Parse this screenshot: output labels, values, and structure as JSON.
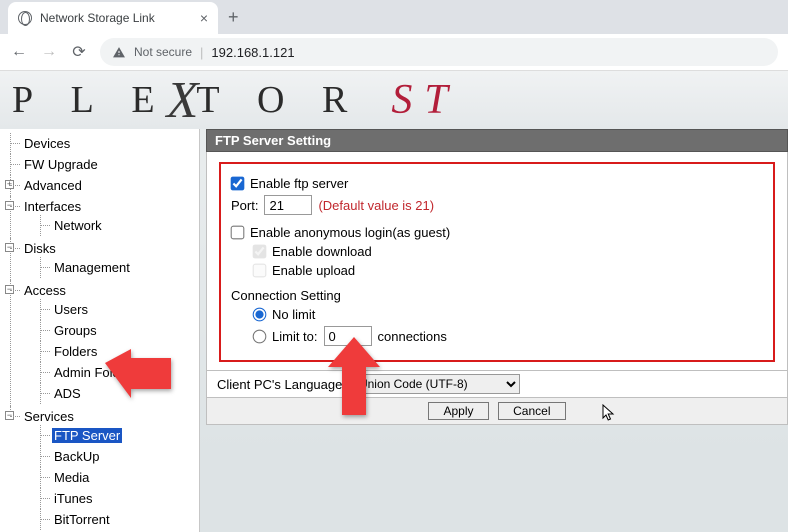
{
  "browser": {
    "tab_title": "Network Storage Link",
    "not_secure": "Not secure",
    "url": "192.168.1.121"
  },
  "logo": {
    "main": "PLEXTOR",
    "sub": "ST"
  },
  "sidebar": {
    "devices": "Devices",
    "fw": "FW Upgrade",
    "advanced": "Advanced",
    "interfaces": "Interfaces",
    "network": "Network",
    "disks": "Disks",
    "management": "Management",
    "access": "Access",
    "users": "Users",
    "groups": "Groups",
    "folders": "Folders",
    "admin_folder": "Admin Folder",
    "ads": "ADS",
    "services": "Services",
    "ftp": "FTP Server",
    "backup": "BackUp",
    "media": "Media",
    "itunes": "iTunes",
    "bittorrent": "BitTorrent"
  },
  "panel": {
    "header": "FTP Server Setting",
    "enable_ftp": "Enable ftp server",
    "port_label": "Port:",
    "port_value": "21",
    "default_hint": "(Default value is 21)",
    "enable_anon": "Enable anonymous login(as guest)",
    "enable_download": "Enable download",
    "enable_upload": "Enable upload",
    "conn_setting": "Connection Setting",
    "no_limit": "No limit",
    "limit_to": "Limit to:",
    "limit_value": "0",
    "connections": "connections",
    "lang_label": "Client PC's Language:",
    "lang_value": "Union Code (UTF-8)",
    "apply": "Apply",
    "cancel": "Cancel"
  }
}
